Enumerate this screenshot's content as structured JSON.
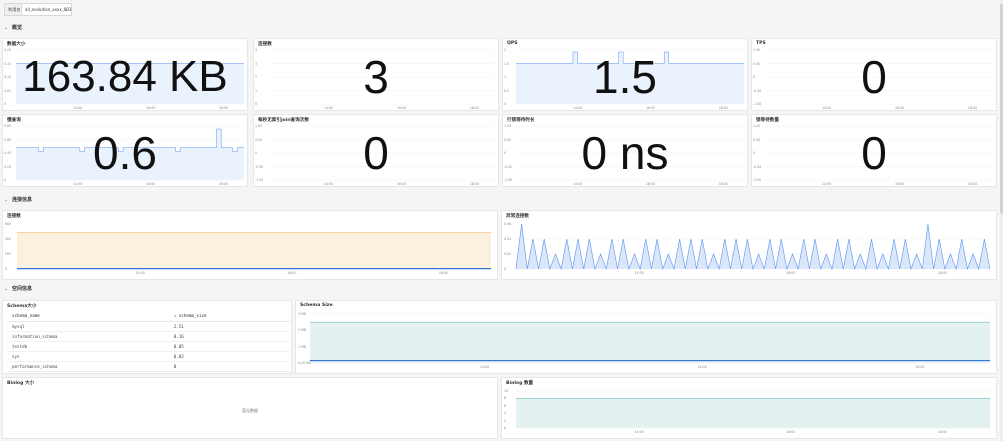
{
  "variables": {
    "label": "利用名",
    "value": "all_evolution_xxxx_003"
  },
  "rows": [
    {
      "title": "概览"
    },
    {
      "title": "连接信息"
    },
    {
      "title": "空间信息"
    }
  ],
  "stat_panels": [
    {
      "title": "数据大小",
      "value": "163.84 KB",
      "yticks": [
        "0.20",
        "0.15",
        "0.10",
        "0.05",
        "0"
      ],
      "xticks": [
        "14:00",
        "16:00",
        "18:00"
      ]
    },
    {
      "title": "连接数",
      "value": "3",
      "yticks": [
        "4",
        "3",
        "2",
        "1",
        "0"
      ],
      "xticks": [
        "14:00",
        "16:00",
        "18:00"
      ]
    },
    {
      "title": "QPS",
      "value": "1.5",
      "yticks": [
        "2",
        "1.5",
        "1",
        "0.5",
        "0"
      ],
      "xticks": [
        "14:00",
        "16:00",
        "18:00"
      ]
    },
    {
      "title": "TPS",
      "value": "0",
      "yticks": [
        "1.00",
        "0.50",
        "0",
        "-0.50",
        "-1.00"
      ],
      "xticks": [
        "14:00",
        "16:00",
        "18:00"
      ]
    },
    {
      "title": "慢查询",
      "value": "0.6",
      "yticks": [
        "0.80",
        "0.60",
        "0.40",
        "0.20",
        "0"
      ],
      "xticks": [
        "14:00",
        "16:00",
        "18:00"
      ]
    },
    {
      "title": "每秒无索引join查询次数",
      "value": "0",
      "yticks": [
        "1.00",
        "0.50",
        "0",
        "-0.50",
        "-1.00"
      ],
      "xticks": [
        "14:00",
        "16:00",
        "18:00"
      ]
    },
    {
      "title": "行锁等待时长",
      "value": "0 ns",
      "yticks": [
        "1.00",
        "0.50",
        "0",
        "-0.50",
        "-1.00"
      ],
      "xticks": [
        "14:00",
        "16:00",
        "18:00"
      ]
    },
    {
      "title": "锁等待数量",
      "value": "0",
      "yticks": [
        "1.00",
        "0.50",
        "0",
        "-0.50",
        "-1.00"
      ],
      "xticks": [
        "14:00",
        "16:00",
        "18:00"
      ]
    }
  ],
  "conn_panels": [
    {
      "title": "连接数",
      "yticks": [
        "600",
        "400",
        "200",
        "0"
      ],
      "xticks": [
        "14:00",
        "16:00",
        "18:00"
      ]
    },
    {
      "title": "异常连接数",
      "yticks": [
        "0.06",
        "0.04",
        "0.02",
        "0"
      ],
      "xticks": [
        "14:00",
        "16:00",
        "18:00"
      ]
    }
  ],
  "schema_panel": {
    "title": "Schema大小",
    "columns": [
      "schema_name",
      "↓ schema_size"
    ],
    "rows": [
      [
        "mysql",
        "2.51"
      ],
      [
        "information_schema",
        "0.16"
      ],
      [
        "testdb",
        "0.05"
      ],
      [
        "sys",
        "0.02"
      ],
      [
        "performance_schema",
        "0"
      ]
    ]
  },
  "schema_size_panel": {
    "title": "Schema Size",
    "yticks": [
      "3 MB",
      "2 MB",
      "1 MB",
      "0.00 MB"
    ],
    "xticks": [
      "14:00",
      "16:00",
      "18:00"
    ]
  },
  "binlog_size_panel": {
    "title": "Binlog 大小",
    "nodata": "暂无数据"
  },
  "binlog_count_panel": {
    "title": "Binlog 数量",
    "yticks": [
      "10",
      "8",
      "6",
      "4",
      "2",
      "0"
    ],
    "xticks": [
      "14:00",
      "16:00",
      "18:00"
    ]
  },
  "colors": {
    "sparkline": "#5794f2",
    "sparkfill": "#eaf2fd",
    "orange": "#f2b25d",
    "orangefill": "#fcf0df",
    "teal": "#73bfb8",
    "tealfill": "#e3f2f0",
    "blue": "#3274d9"
  },
  "chart_data": [
    {
      "type": "area",
      "title": "连接数",
      "series": [
        {
          "values": [
            490,
            490,
            490,
            490,
            490,
            490,
            490,
            490,
            490,
            490
          ]
        },
        {
          "values": [
            5,
            5,
            5,
            5,
            5,
            5,
            5,
            5,
            5,
            5
          ]
        }
      ],
      "ylim": [
        0,
        600
      ]
    },
    {
      "type": "area",
      "title": "异常连接数",
      "series": [
        {
          "values": [
            0,
            0.06,
            0,
            0.04,
            0,
            0.04,
            0,
            0.02,
            0,
            0.04,
            0,
            0.04,
            0,
            0.04,
            0,
            0.02,
            0,
            0.04,
            0,
            0.04,
            0,
            0.02,
            0,
            0.04,
            0,
            0.04,
            0,
            0.02,
            0,
            0.04,
            0,
            0.04,
            0,
            0.04,
            0,
            0.02,
            0,
            0.04,
            0,
            0.04,
            0,
            0.04,
            0,
            0.02,
            0,
            0.04,
            0,
            0.04,
            0,
            0.02,
            0,
            0.04,
            0,
            0.04,
            0,
            0.02,
            0,
            0.04,
            0,
            0.04,
            0,
            0.02,
            0,
            0.04,
            0,
            0.02,
            0,
            0.04,
            0,
            0.04,
            0,
            0.02,
            0,
            0.06,
            0,
            0.04,
            0,
            0.02,
            0,
            0.04,
            0,
            0.02,
            0,
            0.04,
            0
          ]
        }
      ],
      "ylim": [
        0,
        0.06
      ]
    },
    {
      "type": "area",
      "title": "Schema Size",
      "series": [
        {
          "values": [
            2.5,
            2.5,
            2.5,
            2.5,
            2.5,
            2.5,
            2.5,
            2.5,
            2.5,
            2.5
          ]
        },
        {
          "values": [
            0.15,
            0.15,
            0.15,
            0.15,
            0.15,
            0.15,
            0.15,
            0.15,
            0.15,
            0.15
          ]
        }
      ],
      "ylim": [
        0,
        3
      ]
    },
    {
      "type": "area",
      "title": "Binlog 数量",
      "series": [
        {
          "values": [
            8,
            8,
            8,
            8,
            8,
            8,
            8,
            8,
            8,
            8
          ]
        }
      ],
      "ylim": [
        0,
        10
      ]
    }
  ]
}
